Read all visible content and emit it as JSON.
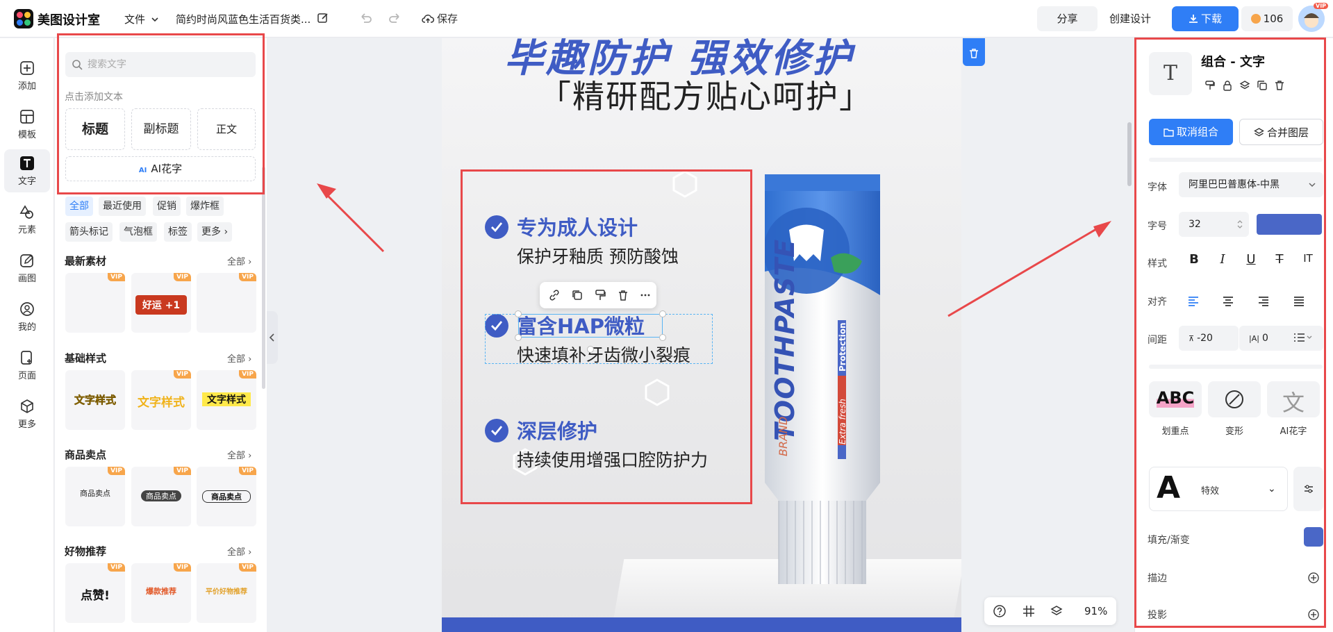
{
  "topbar": {
    "app_name": "美图设计室",
    "file_menu": "文件",
    "doc_title": "简约时尚风蓝色生活百货类...",
    "save": "保存",
    "share": "分享",
    "create": "创建设计",
    "download": "下载",
    "points": "106",
    "vip_badge": "VIP",
    "brand_color": "#2f7ef6"
  },
  "iconnav": {
    "items": [
      {
        "label": "添加",
        "icon": "plus-square-icon"
      },
      {
        "label": "模板",
        "icon": "layout-icon"
      },
      {
        "label": "文字",
        "icon": "text-icon"
      },
      {
        "label": "元素",
        "icon": "shapes-icon"
      },
      {
        "label": "画图",
        "icon": "pencil-icon"
      },
      {
        "label": "我的",
        "icon": "user-icon"
      },
      {
        "label": "页面",
        "icon": "page-icon"
      },
      {
        "label": "更多",
        "icon": "cube-icon"
      }
    ]
  },
  "textpanel": {
    "search_placeholder": "搜索文字",
    "hint": "点击添加文本",
    "add_title": "标题",
    "add_subtitle": "副标题",
    "add_body": "正文",
    "ai_tag": "AI",
    "ai_art": "AI花字",
    "chips_row1": [
      "全部",
      "最近使用",
      "促销",
      "爆炸框"
    ],
    "chips_row2": [
      "箭头标记",
      "气泡框",
      "标签",
      "更多"
    ],
    "sections": [
      {
        "title": "最新素材",
        "all": "全部",
        "thumbs": [
          [
            "",
            "VIP"
          ],
          [
            "好运 +1",
            "VIP"
          ],
          [
            "",
            "VIP"
          ]
        ]
      },
      {
        "title": "基础样式",
        "all": "全部",
        "thumbs": [
          [
            "文字样式",
            ""
          ],
          [
            "文字样式",
            "VIP"
          ],
          [
            "文字样式",
            "VIP"
          ]
        ]
      },
      {
        "title": "商品卖点",
        "all": "全部",
        "thumbs": [
          [
            "商品卖点",
            "VIP"
          ],
          [
            "商品卖点",
            "VIP"
          ],
          [
            "商品卖点",
            "VIP"
          ]
        ]
      },
      {
        "title": "好物推荐",
        "all": "全部",
        "thumbs": [
          [
            "点赞!",
            "VIP"
          ],
          [
            "爆款推荐",
            "VIP"
          ],
          [
            "平价好物推荐",
            "VIP"
          ]
        ]
      }
    ]
  },
  "canvas": {
    "headline": "毕趣防护 强效修护",
    "subline": "「精研配方贴心呵护」",
    "features": [
      {
        "title": "专为成人设计",
        "sub": "保护牙釉质 预防酸蚀"
      },
      {
        "title": "富含HAP微粒",
        "sub": "快速填补牙齿微小裂痕"
      },
      {
        "title": "深层修护",
        "sub": "持续使用增强口腔防护力"
      }
    ],
    "tube_main": "TOOTHPASTE",
    "tube_brand": "BRAND",
    "tube_protection": "Protection",
    "tube_extra": "Extra fresh",
    "accent_color": "#3f5cc4"
  },
  "canvas_tools": {
    "zoom": "91%"
  },
  "props": {
    "title": "组合 - 文字",
    "ungroup": "取消组合",
    "merge": "合并图层",
    "font_label": "字体",
    "font_value": "阿里巴巴普惠体-中黑",
    "size_label": "字号",
    "size_value": "32",
    "style_label": "样式",
    "align_label": "对齐",
    "spacing_label": "间距",
    "letter_spacing": "-20",
    "line_spacing": "0",
    "highlight_label": "划重点",
    "transform_label": "变形",
    "ai_label": "AI花字",
    "effect_label": "特效",
    "fill_label": "填充/渐变",
    "stroke_label": "描边",
    "shadow_label": "投影",
    "fill_color": "#4a67c7"
  }
}
